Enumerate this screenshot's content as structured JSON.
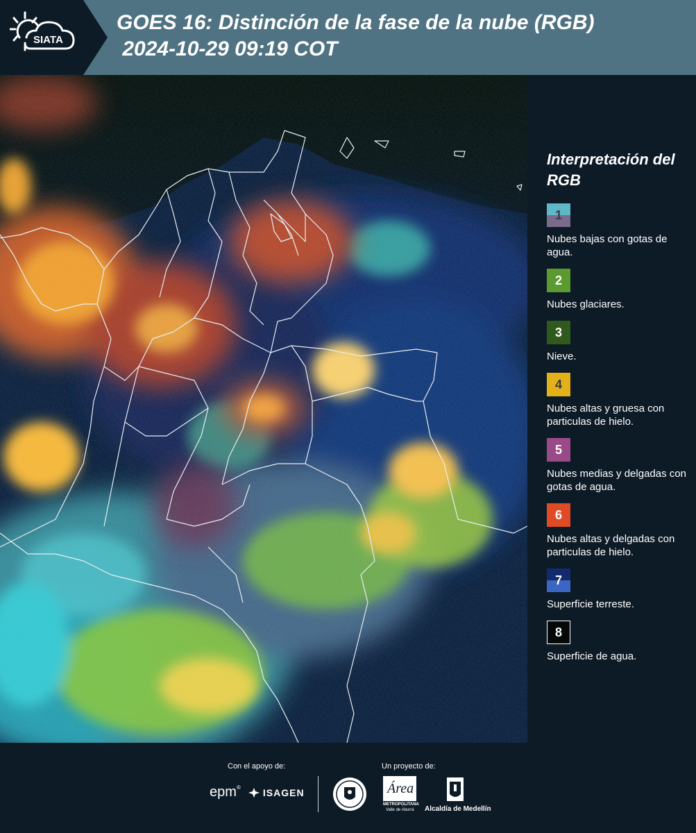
{
  "header": {
    "logo_text": "SIATA",
    "title": "GOES 16: Distinción de la fase de la nube (RGB)\n 2024-10-29 09:19 COT"
  },
  "legend": {
    "title": "Interpretación del RGB",
    "items": [
      {
        "number": "1",
        "label": "Nubes bajas con gotas de agua.",
        "top": "#5fb8c8",
        "bottom": "#7a6b8c",
        "text_color": "#3a3a4a"
      },
      {
        "number": "2",
        "label": "Nubes glaciares.",
        "top": "#5a9a2e",
        "bottom": "#5a9a2e",
        "text_color": "#ffffff"
      },
      {
        "number": "3",
        "label": "Nieve.",
        "top": "#2f5a1c",
        "bottom": "#2f5a1c",
        "text_color": "#ffffff"
      },
      {
        "number": "4",
        "label": "Nubes altas y gruesa con particulas de hielo.",
        "top": "#e3b21b",
        "bottom": "#e3b21b",
        "text_color": "#3a3a3a"
      },
      {
        "number": "5",
        "label": "Nubes medias y delgadas con gotas de agua.",
        "top": "#9a4a86",
        "bottom": "#9a4a86",
        "text_color": "#ffffff"
      },
      {
        "number": "6",
        "label": "Nubes altas y delgadas con particulas de hielo.",
        "top": "#e04b25",
        "bottom": "#e04b25",
        "text_color": "#ffffff"
      },
      {
        "number": "7",
        "label": "Superficie terreste.",
        "top": "#142a6e",
        "bottom": "#3c66c4",
        "text_color": "#ffffff"
      },
      {
        "number": "8",
        "label": "Superficie de agua.",
        "top": "#050a08",
        "bottom": "#050a08",
        "text_color": "#ffffff"
      }
    ]
  },
  "footer": {
    "support_label": "Con el apoyo de:",
    "project_label": "Un proyecto de:",
    "sponsor_epm": "epm",
    "sponsor_isagen": "ISAGEN",
    "area_label": "METROPOLITANA",
    "area_sub": "Valle de Aburrá",
    "alcaldia_label": "Alcaldía de Medellín"
  }
}
